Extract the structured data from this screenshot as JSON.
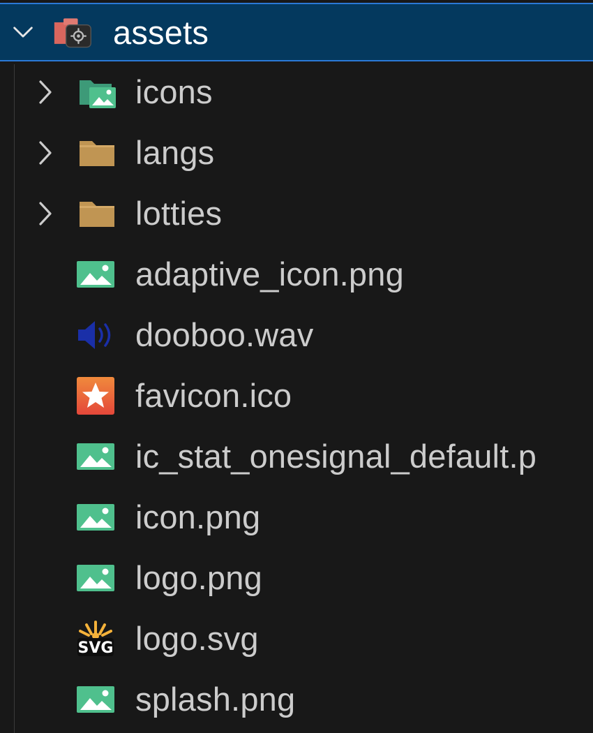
{
  "explorer": {
    "root": {
      "label": "assets",
      "icon": "folder-config-icon",
      "expanded": true
    },
    "folders": [
      {
        "label": "icons",
        "icon": "folder-images-icon",
        "expanded": false
      },
      {
        "label": "langs",
        "icon": "folder-icon",
        "expanded": false
      },
      {
        "label": "lotties",
        "icon": "folder-icon",
        "expanded": false
      }
    ],
    "files": [
      {
        "label": "adaptive_icon.png",
        "icon": "image-file-icon"
      },
      {
        "label": "dooboo.wav",
        "icon": "audio-file-icon"
      },
      {
        "label": "favicon.ico",
        "icon": "favicon-file-icon"
      },
      {
        "label": "ic_stat_onesignal_default.p",
        "icon": "image-file-icon"
      },
      {
        "label": "icon.png",
        "icon": "image-file-icon"
      },
      {
        "label": "logo.png",
        "icon": "image-file-icon"
      },
      {
        "label": "logo.svg",
        "icon": "svg-file-icon"
      },
      {
        "label": "splash.png",
        "icon": "image-file-icon"
      }
    ]
  },
  "colors": {
    "background": "#181818",
    "selection": "#04395e",
    "selection_border": "#2b79d6",
    "text": "#cccccc",
    "image_icon": "#4fc08d",
    "folder": "#c09553"
  }
}
